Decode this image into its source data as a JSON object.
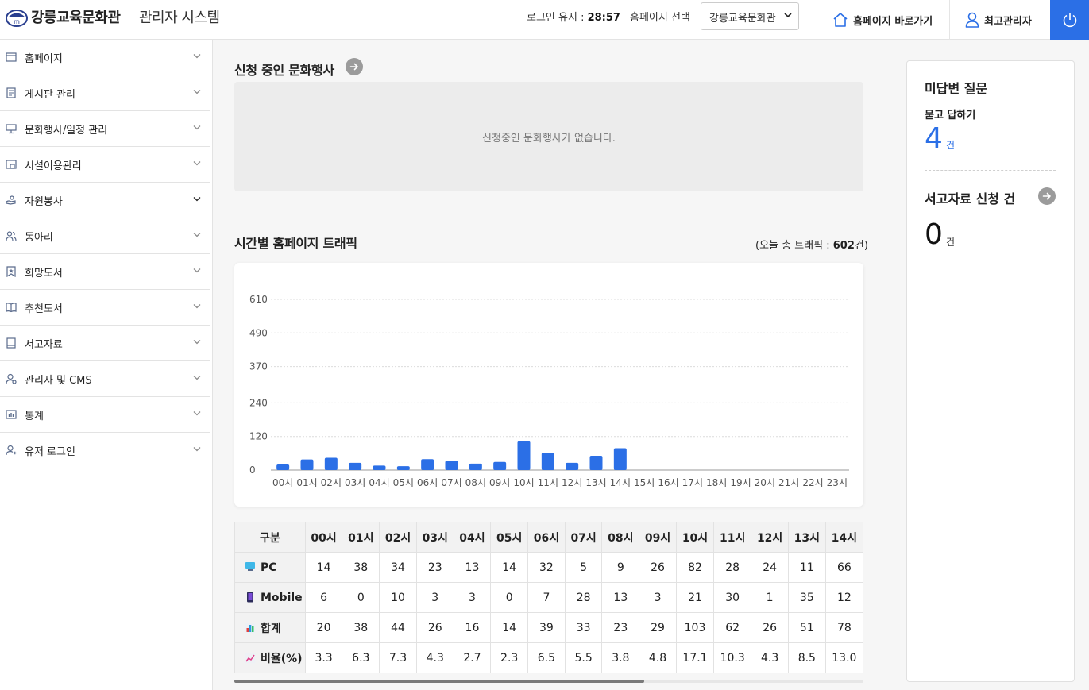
{
  "header": {
    "logo_text": "강릉교육문화관",
    "system_title": "관리자 시스템",
    "login_keep_label": "로그인 유지 : ",
    "login_keep_time": "28:57",
    "homepage_select_label": "홈페이지 선택",
    "homepage_select_value": "강릉교육문화관",
    "goto_homepage": "홈페이지 바로가기",
    "admin_user": "최고관리자"
  },
  "sidebar": {
    "items": [
      {
        "label": "홈페이지",
        "icon": "window-icon"
      },
      {
        "label": "게시판 관리",
        "icon": "board-icon"
      },
      {
        "label": "문화행사/일정 관리",
        "icon": "monitor-icon"
      },
      {
        "label": "시설이용관리",
        "icon": "facility-icon"
      },
      {
        "label": "자원봉사",
        "icon": "volunteer-icon"
      },
      {
        "label": "동아리",
        "icon": "users-icon"
      },
      {
        "label": "희망도서",
        "icon": "bookmark-star-icon"
      },
      {
        "label": "추천도서",
        "icon": "open-book-icon"
      },
      {
        "label": "서고자료",
        "icon": "archive-book-icon"
      },
      {
        "label": "관리자 및 CMS",
        "icon": "admin-user-icon"
      },
      {
        "label": "통계",
        "icon": "bar-chart-icon"
      },
      {
        "label": "유저 로그인",
        "icon": "user-login-icon"
      }
    ]
  },
  "events": {
    "title": "신청 중인 문화행사",
    "empty_message": "신청중인 문화행사가 없습니다."
  },
  "traffic": {
    "title": "시간별 홈페이지 트래픽",
    "total_prefix": "(오늘 총 트래픽 : ",
    "total_value": "602",
    "total_suffix": "건)"
  },
  "chart_data": {
    "type": "bar",
    "categories": [
      "00시",
      "01시",
      "02시",
      "03시",
      "04시",
      "05시",
      "06시",
      "07시",
      "08시",
      "09시",
      "10시",
      "11시",
      "12시",
      "13시",
      "14시",
      "15시",
      "16시",
      "17시",
      "18시",
      "19시",
      "20시",
      "21시",
      "22시",
      "23시"
    ],
    "values": [
      20,
      38,
      44,
      26,
      16,
      14,
      39,
      33,
      23,
      29,
      103,
      62,
      26,
      51,
      78,
      0,
      0,
      0,
      0,
      0,
      0,
      0,
      0,
      0
    ],
    "y_ticks": [
      "610",
      "490",
      "370",
      "240",
      "120",
      "0"
    ],
    "ylim": [
      0,
      610
    ],
    "grid": true,
    "bar_color": "#2b6fe6"
  },
  "table": {
    "corner_header": "구분",
    "hours": [
      "00시",
      "01시",
      "02시",
      "03시",
      "04시",
      "05시",
      "06시",
      "07시",
      "08시",
      "09시",
      "10시",
      "11시",
      "12시",
      "13시",
      "14시"
    ],
    "rows": [
      {
        "label": "PC",
        "icon": "computer-icon",
        "values": [
          "14",
          "38",
          "34",
          "23",
          "13",
          "14",
          "32",
          "5",
          "9",
          "26",
          "82",
          "28",
          "24",
          "11",
          "66"
        ]
      },
      {
        "label": "Mobile",
        "icon": "mobile-phone-icon",
        "values": [
          "6",
          "0",
          "10",
          "3",
          "3",
          "0",
          "7",
          "28",
          "13",
          "3",
          "21",
          "30",
          "1",
          "35",
          "12"
        ]
      },
      {
        "label": "합계",
        "icon": "bar-chart-emoji-icon",
        "values": [
          "20",
          "38",
          "44",
          "26",
          "16",
          "14",
          "39",
          "33",
          "23",
          "29",
          "103",
          "62",
          "26",
          "51",
          "78"
        ]
      },
      {
        "label": "비율(%)",
        "icon": "trend-up-chart-icon",
        "values": [
          "3.3",
          "6.3",
          "7.3",
          "4.3",
          "2.7",
          "2.3",
          "6.5",
          "5.5",
          "3.8",
          "4.8",
          "17.1",
          "10.3",
          "4.3",
          "8.5",
          "13.0"
        ]
      }
    ]
  },
  "right_panel": {
    "unanswered_title": "미답변 질문",
    "qna_label": "묻고 답하기",
    "qna_count": "4",
    "unit": "건",
    "archive_title": "서고자료 신청 건",
    "archive_count": "0"
  },
  "colors": {
    "accent": "#2b6fe6",
    "count_blue": "#2b6fe6"
  }
}
